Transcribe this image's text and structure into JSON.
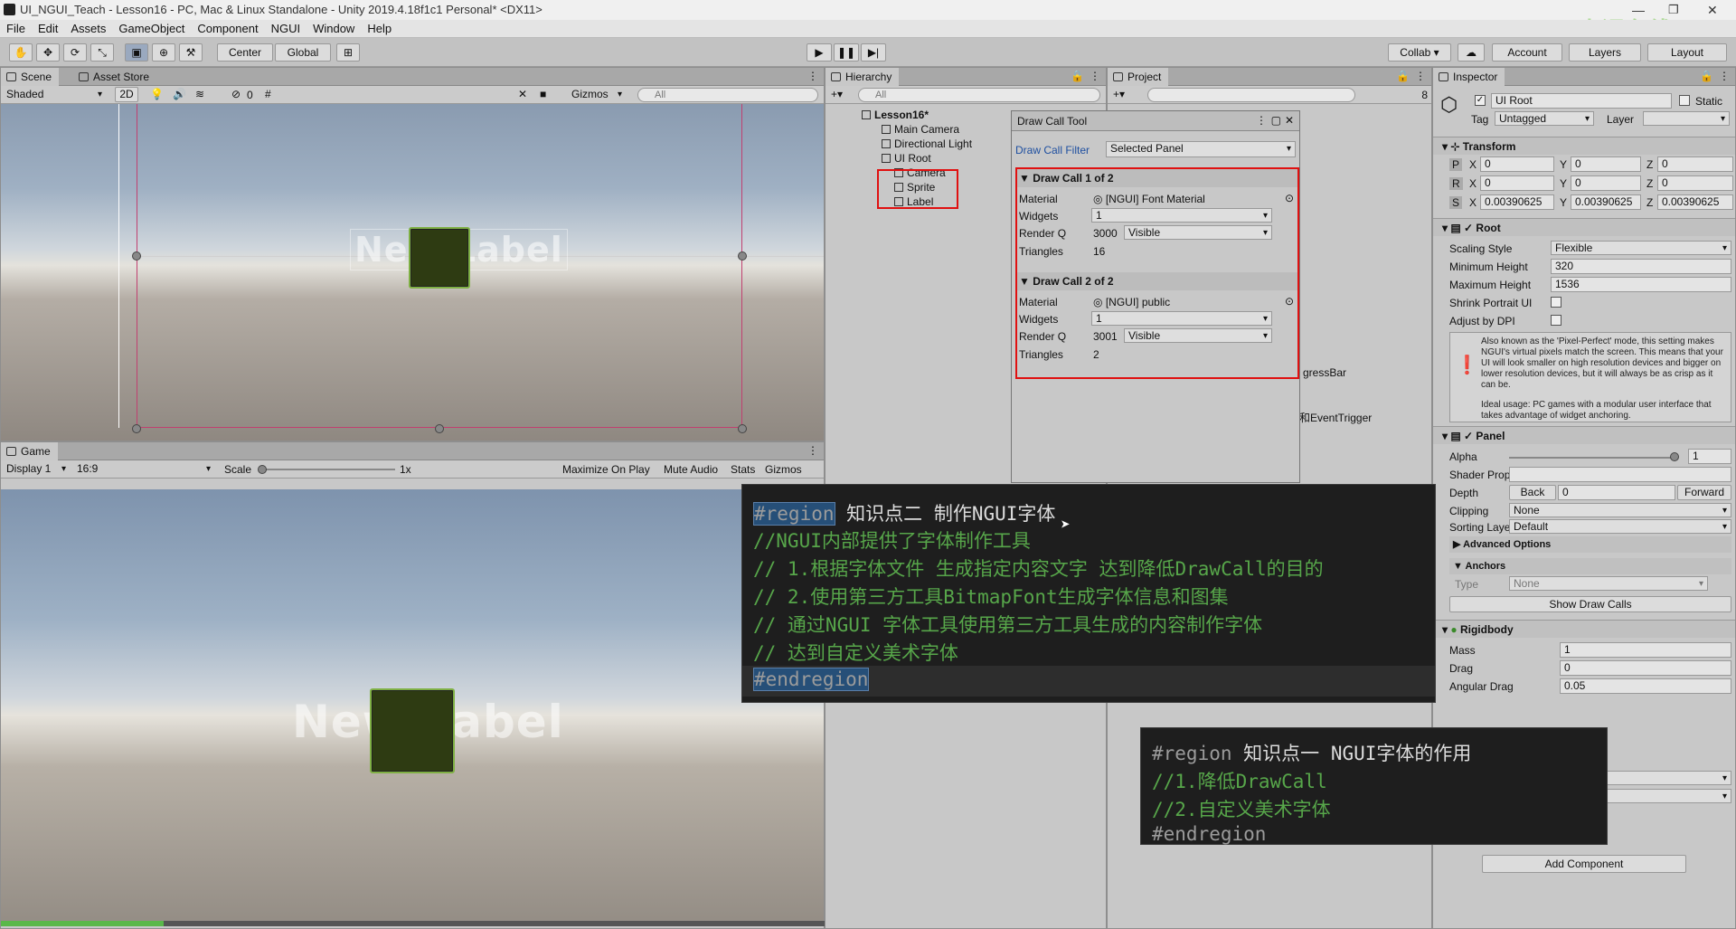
{
  "window": {
    "title": "UI_NGUI_Teach - Lesson16 - PC, Mac & Linux Standalone - Unity 2019.4.18f1c1 Personal* <DX11>"
  },
  "watermark": "泰课在线",
  "menu": [
    "File",
    "Edit",
    "Assets",
    "GameObject",
    "Component",
    "NGUI",
    "Window",
    "Help"
  ],
  "toolbar": {
    "center_label": "Center",
    "global_label": "Global",
    "collab_label": "Collab ▾",
    "account_label": "Account",
    "layers_label": "Layers",
    "layout_label": "Layout"
  },
  "scene": {
    "tab_scene": "Scene",
    "tab_asset_store": "Asset Store",
    "shading": "Shaded",
    "mode_2d": "2D",
    "gizmos": "Gizmos",
    "search_placeholder": "All",
    "hidden_count": "0",
    "ghost_label": "New Label"
  },
  "game": {
    "tab": "Game",
    "display": "Display 1",
    "aspect": "16:9",
    "scale_label": "Scale",
    "scale_value": "1x",
    "maximize": "Maximize On Play",
    "mute": "Mute Audio",
    "stats": "Stats",
    "gizmos": "Gizmos",
    "ghost_label": "New Label",
    "progress": 0.094
  },
  "hierarchy": {
    "tab": "Hierarchy",
    "search_placeholder": "All",
    "items": [
      "Lesson16*",
      "Main Camera",
      "Directional Light",
      "UI Root",
      "Camera",
      "Sprite",
      "Label"
    ],
    "partial_items": [
      "gressBar",
      "和EventTrigger"
    ]
  },
  "project": {
    "tab": "Project",
    "count": "8"
  },
  "draw_call_tool": {
    "title": "Draw Call Tool",
    "filter_label": "Draw Call Filter",
    "filter_value": "Selected Panel",
    "calls": [
      {
        "header": "Draw Call 1 of 2",
        "material": "[NGUI] Font Material",
        "widgets": "1",
        "render_q": "3000",
        "visibility": "Visible",
        "triangles": "16"
      },
      {
        "header": "Draw Call 2 of 2",
        "material": "[NGUI] public",
        "widgets": "1",
        "render_q": "3001",
        "visibility": "Visible",
        "triangles": "2"
      }
    ],
    "labels": {
      "material": "Material",
      "widgets": "Widgets",
      "render_q": "Render Q",
      "triangles": "Triangles"
    }
  },
  "inspector": {
    "tab": "Inspector",
    "object_name": "UI Root",
    "static_label": "Static",
    "tag_label": "Tag",
    "tag_value": "Untagged",
    "layer_label": "Layer",
    "transform": {
      "title": "Transform",
      "p": [
        "0",
        "0",
        "0"
      ],
      "r": [
        "0",
        "0",
        "0"
      ],
      "s": [
        "0.00390625",
        "0.00390625",
        "0.00390625"
      ]
    },
    "root": {
      "title": "Root",
      "scaling_style_label": "Scaling Style",
      "scaling_style": "Flexible",
      "min_height_label": "Minimum Height",
      "min_height": "320",
      "max_height_label": "Maximum Height",
      "max_height": "1536",
      "shrink_label": "Shrink Portrait UI",
      "dpi_label": "Adjust by DPI",
      "help": "Also known as the 'Pixel-Perfect' mode, this setting makes NGUI's virtual pixels match the screen. This means that your UI will look smaller on high resolution devices and bigger on lower resolution devices, but it will always be as crisp as it can be.",
      "help2": "Ideal usage: PC games with a modular user interface that takes advantage of widget anchoring."
    },
    "panel": {
      "title": "Panel",
      "alpha_label": "Alpha",
      "alpha": "1",
      "shader_label": "Shader Prop.",
      "depth_label": "Depth",
      "back": "Back",
      "depth": "0",
      "forward": "Forward",
      "clipping_label": "Clipping",
      "clipping": "None",
      "sorting_label": "Sorting Layer",
      "sorting": "Default",
      "advanced": "Advanced Options",
      "anchors": "Anchors",
      "type_label": "Type",
      "type": "None",
      "show_draw_calls": "Show Draw Calls"
    },
    "rigidbody": {
      "title": "Rigidbody",
      "mass_label": "Mass",
      "mass": "1",
      "drag_label": "Drag",
      "drag": "0",
      "angular_label": "Angular Drag",
      "angular": "0.05"
    },
    "add_component": "Add Component"
  },
  "code_main": {
    "region_kw": "#region",
    "region_title": "知识点二 制作NGUI字体",
    "lines": [
      "//NGUI内部提供了字体制作工具",
      "// 1.根据字体文件 生成指定内容文字 达到降低DrawCall的目的",
      "// 2.使用第三方工具BitmapFont生成字体信息和图集",
      "//   通过NGUI 字体工具使用第三方工具生成的内容制作字体",
      "//   达到自定义美术字体"
    ],
    "endregion": "#endregion"
  },
  "code_small": {
    "region_kw": "#region",
    "region_title": "知识点一 NGUI字体的作用",
    "lines": [
      "//1.降低DrawCall",
      "//2.自定义美术字体"
    ],
    "endregion": "#endregion"
  },
  "colors": {
    "accent_red": "#e01010",
    "code_comment": "#57a64a",
    "code_bg": "#1e1e1e",
    "sprite_border": "#7fb044"
  }
}
